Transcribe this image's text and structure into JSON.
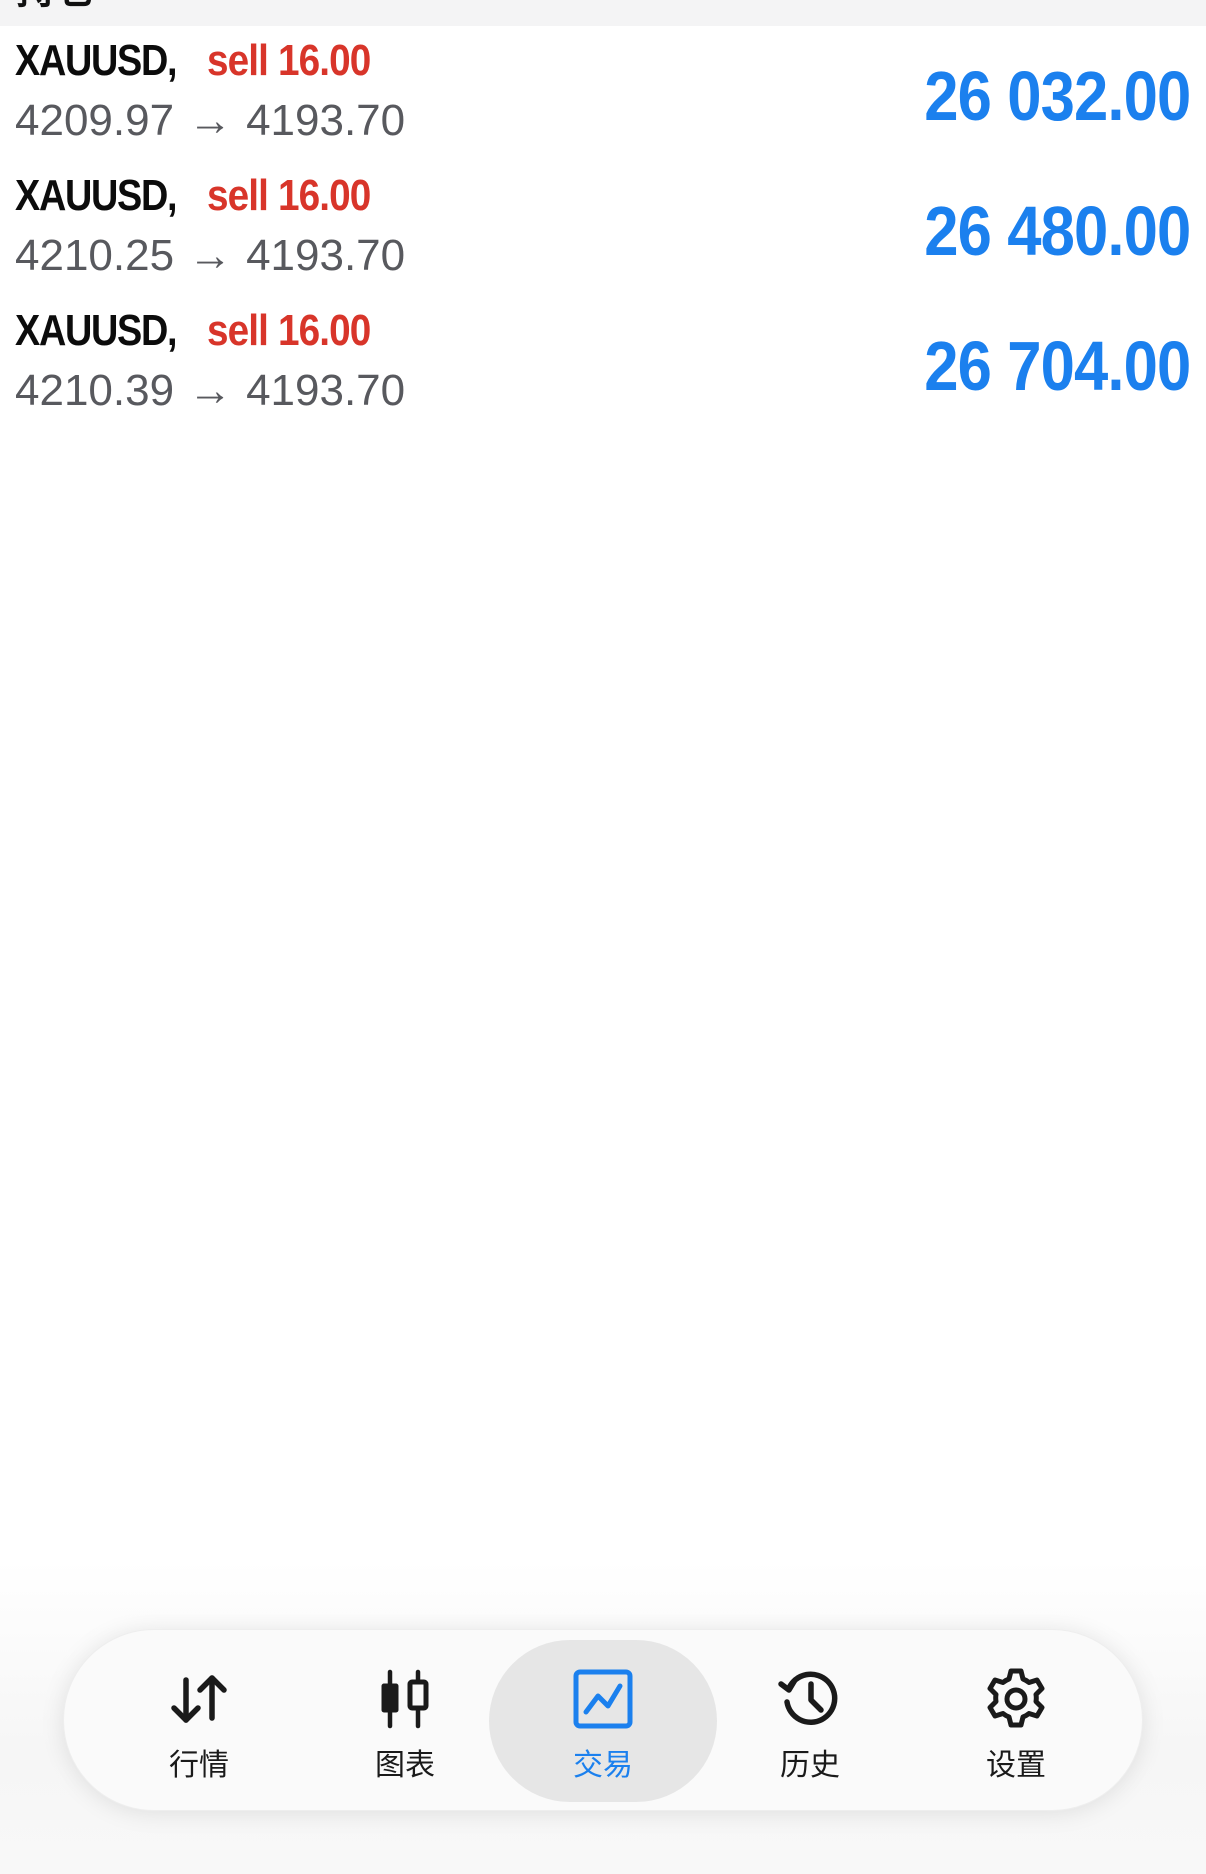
{
  "header": {
    "title": "持仓"
  },
  "positions": [
    {
      "symbol": "XAUUSD,",
      "trade": "sell 16.00",
      "open_price": "4209.97",
      "arrow": "→",
      "current_price": "4193.70",
      "profit": "26 032.00"
    },
    {
      "symbol": "XAUUSD,",
      "trade": "sell 16.00",
      "open_price": "4210.25",
      "arrow": "→",
      "current_price": "4193.70",
      "profit": "26 480.00"
    },
    {
      "symbol": "XAUUSD,",
      "trade": "sell 16.00",
      "open_price": "4210.39",
      "arrow": "→",
      "current_price": "4193.70",
      "profit": "26 704.00"
    }
  ],
  "tabs": [
    {
      "label": "行情",
      "icon": "quotes-arrows-icon",
      "active": false
    },
    {
      "label": "图表",
      "icon": "candlestick-chart-icon",
      "active": false
    },
    {
      "label": "交易",
      "icon": "trade-chart-icon",
      "active": true
    },
    {
      "label": "历史",
      "icon": "history-clock-icon",
      "active": false
    },
    {
      "label": "设置",
      "icon": "gear-icon",
      "active": false
    }
  ],
  "colors": {
    "sell": "#d8352a",
    "profit": "#1b80ee",
    "active_tab": "#1b80ee",
    "symbol": "#0c0c0c",
    "price": "#58595e"
  }
}
